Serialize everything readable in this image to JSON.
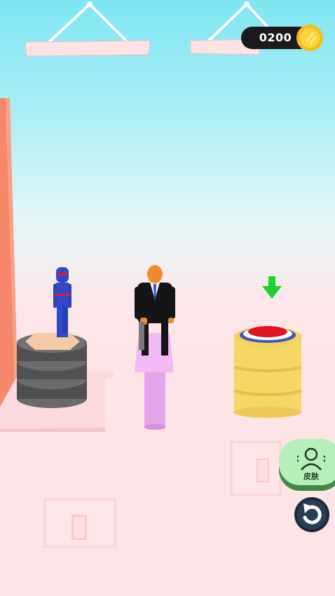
{
  "hud": {
    "coins": "0200",
    "coin_icon": "gold-coin-icon"
  },
  "buttons": {
    "skin_label": "皮肤",
    "skin_icon": "avatar-skin-icon",
    "restart_icon": "restart-icon"
  },
  "scene": {
    "characters": [
      "blue-ninja-figure",
      "agent-in-black-suit-holding-drill"
    ],
    "target_marker": "green-down-arrow-icon"
  },
  "colors": {
    "sky_top": "#7ee6f2",
    "floor": "#fde3e5",
    "ninja_blue": "#2f49c7",
    "suit_black": "#151416",
    "pedestal_pink": "#e5a6ea",
    "barrel_yellow": "#f6d664",
    "button_red": "#e01521",
    "skin_button_green": "#b7efbb",
    "arrow_green": "#1bd22f"
  }
}
